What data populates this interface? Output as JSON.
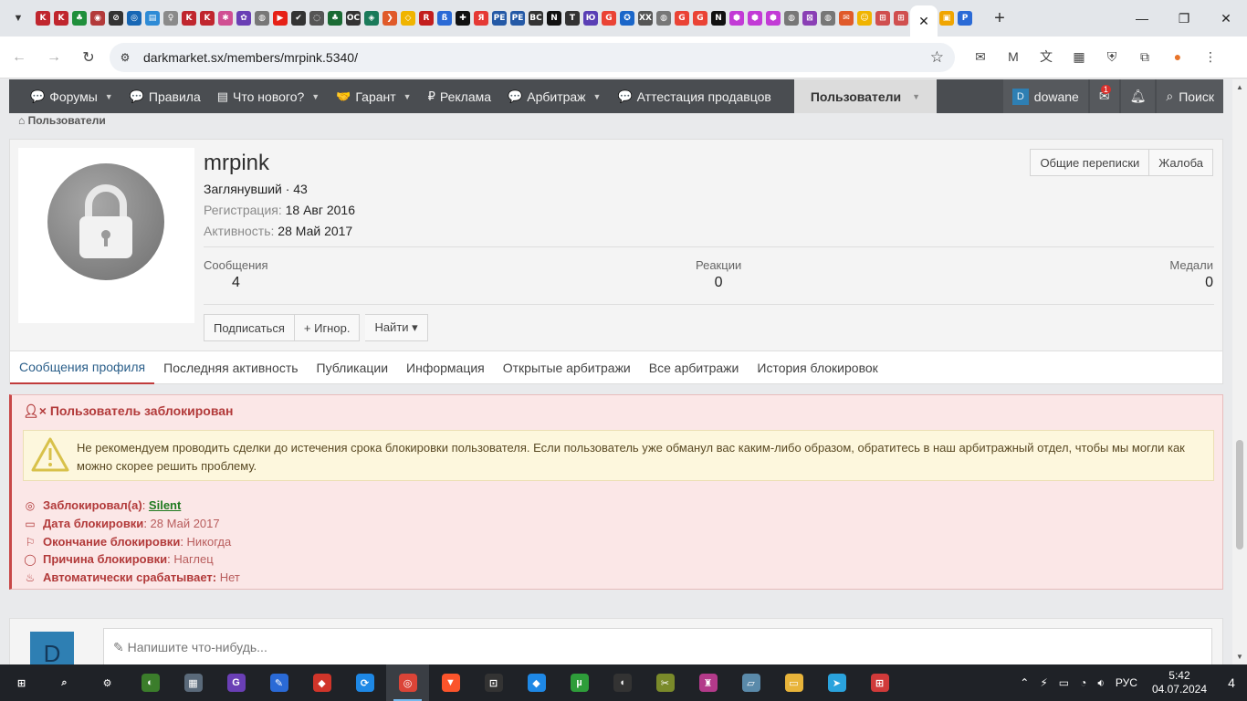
{
  "browser": {
    "url": "darkmarket.sx/members/mrpink.5340/",
    "tab_list_icon": "chevron-down-icon",
    "new_tab": "+",
    "tab_close": "✕",
    "favicons": [
      {
        "g": "K",
        "c": "#c0262e"
      },
      {
        "g": "K",
        "c": "#c0262e"
      },
      {
        "g": "♣",
        "c": "#1f8f3b"
      },
      {
        "g": "◉",
        "c": "#b33a3a"
      },
      {
        "g": "⊘",
        "c": "#333"
      },
      {
        "g": "◎",
        "c": "#1767b5"
      },
      {
        "g": "▤",
        "c": "#2e8bd6"
      },
      {
        "g": "♀",
        "c": "#8a8a8a"
      },
      {
        "g": "K",
        "c": "#c0262e"
      },
      {
        "g": "K",
        "c": "#c0262e"
      },
      {
        "g": "✱",
        "c": "#d04f93"
      },
      {
        "g": "✿",
        "c": "#6a3fb5"
      },
      {
        "g": "◍",
        "c": "#777"
      },
      {
        "g": "▶",
        "c": "#e62117"
      },
      {
        "g": "✔",
        "c": "#333"
      },
      {
        "g": "◌",
        "c": "#555"
      },
      {
        "g": "♣",
        "c": "#1a6b34"
      },
      {
        "g": "OC",
        "c": "#333"
      },
      {
        "g": "◈",
        "c": "#1a7a5a"
      },
      {
        "g": "❯",
        "c": "#e05a2a"
      },
      {
        "g": "◇",
        "c": "#f0b400"
      },
      {
        "g": "R",
        "c": "#c31e1e"
      },
      {
        "g": "ß",
        "c": "#2a6ad6"
      },
      {
        "g": "✚",
        "c": "#111"
      },
      {
        "g": "Я",
        "c": "#e53935"
      },
      {
        "g": "PE",
        "c": "#2459a6"
      },
      {
        "g": "PE",
        "c": "#2459a6"
      },
      {
        "g": "BC",
        "c": "#333"
      },
      {
        "g": "N",
        "c": "#111"
      },
      {
        "g": "T",
        "c": "#333"
      },
      {
        "g": "Ю",
        "c": "#5a3fb5"
      },
      {
        "g": "G",
        "c": "#ea4335"
      },
      {
        "g": "✪",
        "c": "#1a66c9"
      },
      {
        "g": "XX",
        "c": "#555"
      },
      {
        "g": "◍",
        "c": "#777"
      },
      {
        "g": "G",
        "c": "#ea4335"
      },
      {
        "g": "G",
        "c": "#ea4335"
      },
      {
        "g": "N",
        "c": "#111"
      },
      {
        "g": "⬢",
        "c": "#c23bd6"
      },
      {
        "g": "⬢",
        "c": "#c23bd6"
      },
      {
        "g": "⬢",
        "c": "#c23bd6"
      },
      {
        "g": "◍",
        "c": "#777"
      },
      {
        "g": "⊠",
        "c": "#8a3fb5"
      },
      {
        "g": "◍",
        "c": "#777"
      },
      {
        "g": "✉",
        "c": "#e05a2a"
      },
      {
        "g": "☺",
        "c": "#f0b400"
      },
      {
        "g": "⊞",
        "c": "#d04f4f"
      },
      {
        "g": "⊞",
        "c": "#d04f4f"
      }
    ],
    "active_tab_favicon": {
      "g": "⊞",
      "c": "#f0a500"
    },
    "after_tabs": [
      {
        "g": "▣",
        "c": "#f0a500"
      },
      {
        "g": "P",
        "c": "#2a6ad6"
      }
    ],
    "window": {
      "minimize": "—",
      "maximize": "❐",
      "close": "✕"
    },
    "toolbar": {
      "back": "←",
      "forward": "→",
      "reload": "↻",
      "site_info": "⚙",
      "star": "☆"
    },
    "extensions": [
      "✉",
      "M",
      "文",
      "▦",
      "⛨",
      "⧉",
      "●",
      "⋮"
    ]
  },
  "forum_nav": {
    "items": [
      {
        "icon": "comments-icon",
        "glyph": "💬",
        "label": "Форумы",
        "dropdown": true
      },
      {
        "icon": "comment-icon",
        "glyph": "💬",
        "label": "Правила",
        "dropdown": false
      },
      {
        "icon": "newspaper-icon",
        "glyph": "▤",
        "label": "Что нового?",
        "dropdown": true
      },
      {
        "icon": "handshake-icon",
        "glyph": "🤝",
        "label": "Гарант",
        "dropdown": true
      },
      {
        "icon": "ruble-icon",
        "glyph": "₽",
        "label": "Реклама",
        "dropdown": false
      },
      {
        "icon": "comment-icon",
        "glyph": "💬",
        "label": "Арбитраж",
        "dropdown": true
      },
      {
        "icon": "comment-icon",
        "glyph": "💬",
        "label": "Аттестация продавцов",
        "dropdown": false
      }
    ],
    "active": {
      "label": "Пользователи",
      "dropdown": true
    },
    "user": {
      "initial": "D",
      "name": "dowane"
    },
    "messages_badge": "1",
    "search": "Поиск"
  },
  "breadcrumb": "Пользователи",
  "member": {
    "username": "mrpink",
    "title_line": "Заглянувший · 43",
    "registration_label": "Регистрация:",
    "registration": "18 Авг 2016",
    "activity_label": "Активность:",
    "activity": "28 Май 2017",
    "buttons": {
      "conversations": "Общие переписки",
      "report": "Жалоба"
    },
    "stats": {
      "messages_label": "Сообщения",
      "messages": "4",
      "reactions_label": "Реакции",
      "reactions": "0",
      "medals_label": "Медали",
      "medals": "0"
    },
    "actions": {
      "subscribe": "Подписаться",
      "ignore": "+ Игнор.",
      "find": "Найти ▾"
    }
  },
  "profile_tabs": [
    {
      "label": "Сообщения профиля",
      "active": true
    },
    {
      "label": "Последняя активность",
      "active": false
    },
    {
      "label": "Публикации",
      "active": false
    },
    {
      "label": "Информация",
      "active": false
    },
    {
      "label": "Открытые арбитражи",
      "active": false
    },
    {
      "label": "Все арбитражи",
      "active": false
    },
    {
      "label": "История блокировок",
      "active": false
    }
  ],
  "ban": {
    "title": "Пользователь заблокирован",
    "warning": "Не рекомендуем проводить сделки до истечения срока блокировки пользователя. Если пользователь уже обманул вас каким-либо образом, обратитесь в наш арбитражный отдел, чтобы мы могли как можно скорее решить проблему.",
    "banned_by_label": "Заблокировал(а)",
    "banned_by": "Silent",
    "date_label": "Дата блокировки",
    "date": "28 Май 2017",
    "end_label": "Окончание блокировки",
    "end": "Никогда",
    "reason_label": "Причина блокировки",
    "reason": "Наглец",
    "auto_label": "Автоматически срабатывает:",
    "auto": "Нет"
  },
  "reply": {
    "initial": "D",
    "placeholder": "Напишите что-нибудь..."
  },
  "taskbar": {
    "apps": [
      {
        "g": "⊞",
        "c": "transparent"
      },
      {
        "g": "⌕",
        "c": "transparent"
      },
      {
        "g": "⚙",
        "c": "transparent"
      },
      {
        "g": "◐",
        "c": "#3b7d2b"
      },
      {
        "g": "▦",
        "c": "#5a6a7a"
      },
      {
        "g": "G",
        "c": "#6a3fb5"
      },
      {
        "g": "✎",
        "c": "#2a6ad6"
      },
      {
        "g": "◆",
        "c": "#d0352a"
      },
      {
        "g": "⟳",
        "c": "#1e88e5"
      },
      {
        "g": "◎",
        "c": "#db4437",
        "active": true
      },
      {
        "g": "▼",
        "c": "#fb542b"
      },
      {
        "g": "⊡",
        "c": "#333"
      },
      {
        "g": "◆",
        "c": "#1e88e5"
      },
      {
        "g": "µ",
        "c": "#2e9d3a"
      },
      {
        "g": "◖",
        "c": "#333"
      },
      {
        "g": "✂",
        "c": "#7a8a2a"
      },
      {
        "g": "♜",
        "c": "#b33a8a"
      },
      {
        "g": "▱",
        "c": "#5a8aaa"
      },
      {
        "g": "▭",
        "c": "#e8b43a"
      },
      {
        "g": "➤",
        "c": "#2aa3dd"
      },
      {
        "g": "⊞",
        "c": "#d03a3a"
      }
    ],
    "lang": "РУС",
    "time": "5:42",
    "date": "04.07.2024",
    "notifications": "4"
  }
}
